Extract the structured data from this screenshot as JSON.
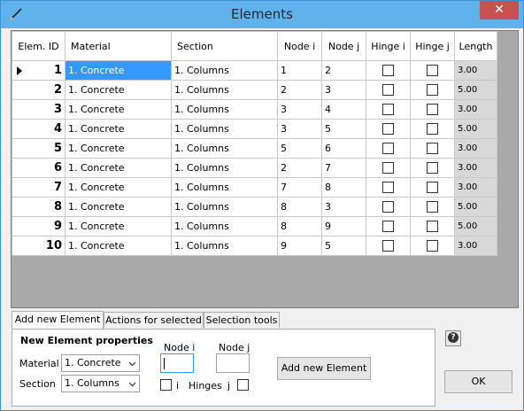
{
  "window": {
    "title": "Elements",
    "close": "✕"
  },
  "grid": {
    "columns": [
      "Elem. ID",
      "Material",
      "Section",
      "Node i",
      "Node j",
      "Hinge i",
      "Hinge j",
      "Length"
    ],
    "rows": [
      {
        "id": "1",
        "material": "1. Concrete",
        "section": "1. Columns",
        "node_i": "1",
        "node_j": "2",
        "hinge_i": false,
        "hinge_j": false,
        "length": "3.00"
      },
      {
        "id": "2",
        "material": "1. Concrete",
        "section": "1. Columns",
        "node_i": "2",
        "node_j": "3",
        "hinge_i": false,
        "hinge_j": false,
        "length": "5.00"
      },
      {
        "id": "3",
        "material": "1. Concrete",
        "section": "1. Columns",
        "node_i": "3",
        "node_j": "4",
        "hinge_i": false,
        "hinge_j": false,
        "length": "3.00"
      },
      {
        "id": "4",
        "material": "1. Concrete",
        "section": "1. Columns",
        "node_i": "3",
        "node_j": "5",
        "hinge_i": false,
        "hinge_j": false,
        "length": "5.00"
      },
      {
        "id": "5",
        "material": "1. Concrete",
        "section": "1. Columns",
        "node_i": "5",
        "node_j": "6",
        "hinge_i": false,
        "hinge_j": false,
        "length": "3.00"
      },
      {
        "id": "6",
        "material": "1. Concrete",
        "section": "1. Columns",
        "node_i": "2",
        "node_j": "7",
        "hinge_i": false,
        "hinge_j": false,
        "length": "3.00"
      },
      {
        "id": "7",
        "material": "1. Concrete",
        "section": "1. Columns",
        "node_i": "7",
        "node_j": "8",
        "hinge_i": false,
        "hinge_j": false,
        "length": "3.00"
      },
      {
        "id": "8",
        "material": "1. Concrete",
        "section": "1. Columns",
        "node_i": "8",
        "node_j": "3",
        "hinge_i": false,
        "hinge_j": false,
        "length": "5.00"
      },
      {
        "id": "9",
        "material": "1. Concrete",
        "section": "1. Columns",
        "node_i": "8",
        "node_j": "9",
        "hinge_i": false,
        "hinge_j": false,
        "length": "5.00"
      },
      {
        "id": "10",
        "material": "1. Concrete",
        "section": "1. Columns",
        "node_i": "9",
        "node_j": "5",
        "hinge_i": false,
        "hinge_j": false,
        "length": "3.00"
      }
    ]
  },
  "tabs": [
    "Add new Element",
    "Actions for selected",
    "Selection tools"
  ],
  "panel": {
    "title": "New Element properties",
    "material_label": "Material",
    "material_value": "1. Concrete",
    "section_label": "Section",
    "section_value": "1. Columns",
    "node_i_label": "Node i",
    "node_j_label": "Node j",
    "node_i_value": "",
    "node_j_value": "",
    "hinge_i_label": "i",
    "hinges_label": "Hinges",
    "hinge_j_label": "j",
    "add_button": "Add new Element"
  },
  "help_icon": "?",
  "ok_button": "OK",
  "colors": {
    "titlebar": "#5fb2ec",
    "selection": "#3399ff",
    "close": "#c75050"
  }
}
